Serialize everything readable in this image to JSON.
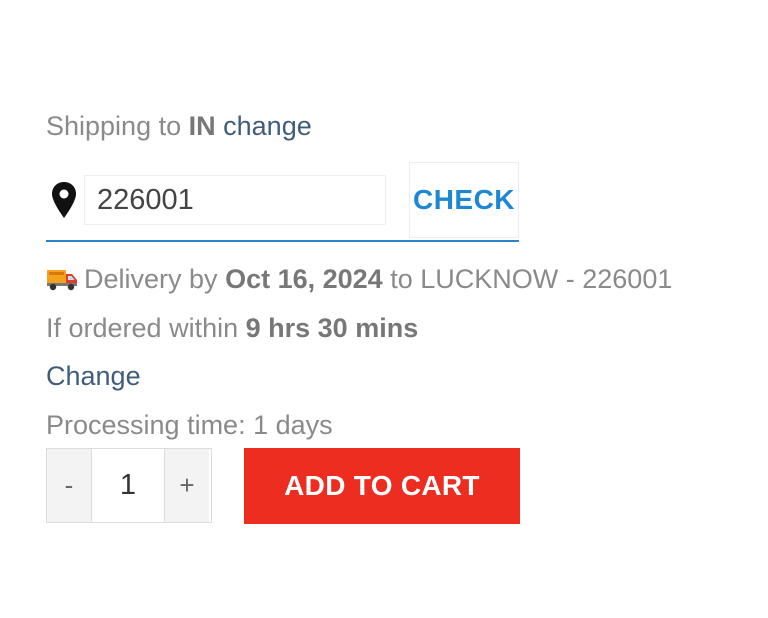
{
  "shipping": {
    "prefix": "Shipping to",
    "country": "IN",
    "change_link": "change"
  },
  "pincode": {
    "value": "226001",
    "check_label": "CHECK",
    "icon": "map-pin-icon"
  },
  "delivery": {
    "icon": "truck-icon",
    "prefix": "Delivery by",
    "date": "Oct 16, 2024",
    "middle": "to",
    "location": "LUCKNOW - 226001"
  },
  "cutoff": {
    "prefix": "If ordered within",
    "time": "9 hrs 30 mins"
  },
  "change_label": "Change",
  "processing": "Processing time: 1 days",
  "quantity": {
    "minus": "-",
    "value": "1",
    "plus": "+"
  },
  "add_to_cart": "ADD TO CART",
  "colors": {
    "accent_blue": "#1e87d4",
    "link": "#3f5d7a",
    "cart_red": "#ec2d20"
  }
}
